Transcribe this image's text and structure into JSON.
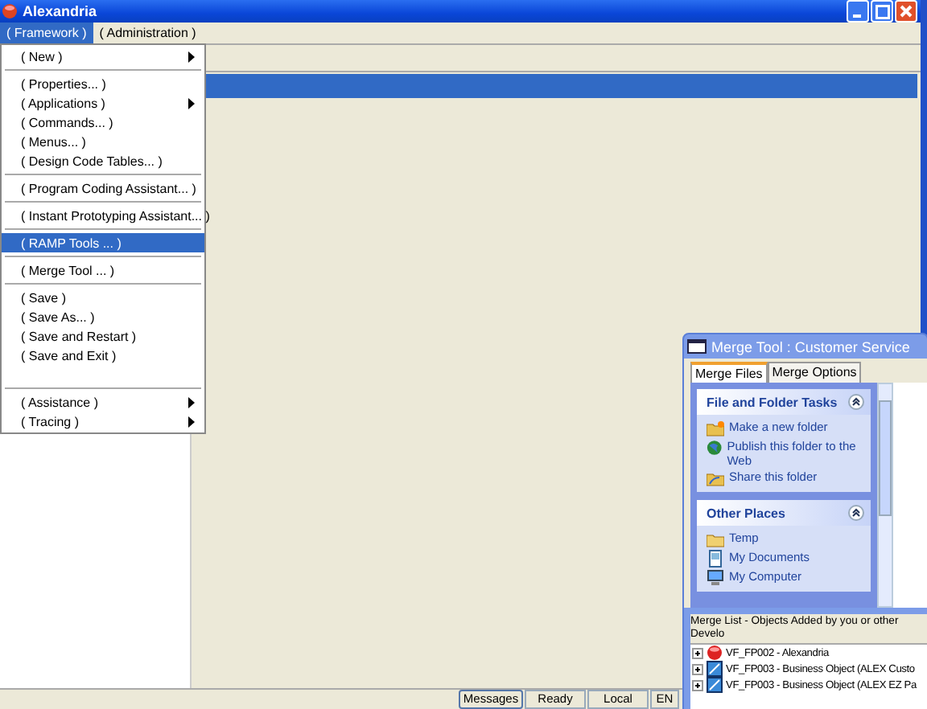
{
  "window": {
    "title": "Alexandria"
  },
  "menubar": [
    {
      "label": "( Framework )",
      "selected": true
    },
    {
      "label": "( Administration )",
      "selected": false
    }
  ],
  "menu": [
    {
      "kind": "item",
      "label": "( New )",
      "submenu": true,
      "selected": false
    },
    {
      "kind": "separator"
    },
    {
      "kind": "item",
      "label": "( Properties... )",
      "submenu": false,
      "selected": false
    },
    {
      "kind": "item",
      "label": "( Applications )",
      "submenu": true,
      "selected": false
    },
    {
      "kind": "item",
      "label": "( Commands... )",
      "submenu": false,
      "selected": false
    },
    {
      "kind": "item",
      "label": "( Menus... )",
      "submenu": false,
      "selected": false
    },
    {
      "kind": "item",
      "label": "( Design Code Tables... )",
      "submenu": false,
      "selected": false
    },
    {
      "kind": "separator"
    },
    {
      "kind": "item",
      "label": "( Program Coding Assistant... )",
      "submenu": false,
      "selected": false
    },
    {
      "kind": "separator"
    },
    {
      "kind": "item",
      "label": "( Instant Prototyping Assistant... )",
      "submenu": false,
      "selected": false
    },
    {
      "kind": "separator"
    },
    {
      "kind": "item",
      "label": "( RAMP Tools ... )",
      "submenu": false,
      "selected": true
    },
    {
      "kind": "separator"
    },
    {
      "kind": "item",
      "label": "( Merge Tool ... )",
      "submenu": false,
      "selected": false
    },
    {
      "kind": "separator"
    },
    {
      "kind": "item",
      "label": "( Save )",
      "submenu": false,
      "selected": false
    },
    {
      "kind": "item",
      "label": "( Save As... )",
      "submenu": false,
      "selected": false
    },
    {
      "kind": "item",
      "label": "( Save and Restart )",
      "submenu": false,
      "selected": false
    },
    {
      "kind": "item",
      "label": "( Save and Exit )",
      "submenu": false,
      "selected": false
    },
    {
      "kind": "blank"
    },
    {
      "kind": "separator"
    },
    {
      "kind": "item",
      "label": "( Assistance )",
      "submenu": true,
      "selected": false
    },
    {
      "kind": "item",
      "label": "( Tracing )",
      "submenu": true,
      "selected": false
    }
  ],
  "status_bar": [
    {
      "label": "Messages",
      "kind": "button"
    },
    {
      "label": "Ready",
      "kind": "pane"
    },
    {
      "label": "Local",
      "kind": "pane"
    },
    {
      "label": "EN",
      "kind": "pane"
    }
  ],
  "merge_tool": {
    "title": "Merge Tool : Customer Service",
    "tabs": [
      {
        "label": "Merge Files",
        "selected": true
      },
      {
        "label": "Merge Options",
        "selected": false
      }
    ],
    "task_panels": [
      {
        "title": "File and Folder Tasks",
        "links": [
          {
            "label": "Make a new folder",
            "kind": "new-folder"
          },
          {
            "label": "Publish this folder to the Web",
            "kind": "globe"
          },
          {
            "label": "Share this folder",
            "kind": "share-folder"
          }
        ]
      },
      {
        "title": "Other Places",
        "links": [
          {
            "label": "Temp",
            "kind": "folder"
          },
          {
            "label": "My Documents",
            "kind": "documents"
          },
          {
            "label": "My Computer",
            "kind": "computer"
          }
        ]
      }
    ],
    "merge_list": {
      "header": "Merge List - Objects Added by you or other Develo",
      "rows": [
        {
          "label": "VF_FP002 - Alexandria",
          "kind": "application"
        },
        {
          "label": "VF_FP003 - Business Object (ALEX Custo",
          "kind": "object"
        },
        {
          "label": "VF_FP003 - Business Object (ALEX EZ Pa",
          "kind": "object"
        }
      ]
    }
  }
}
